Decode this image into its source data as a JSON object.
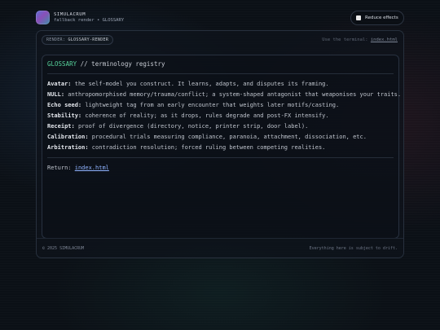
{
  "brand": {
    "name": "SIMULACRUM",
    "subtitle": "fallback render • GLOSSARY",
    "logo_icon": "gradient-square-logo"
  },
  "controls": {
    "reduce_effects_label": "Reduce effects",
    "reduce_effects_checked": false
  },
  "panel": {
    "render_label": "RENDER:",
    "render_value": "GLOSSARY-RENDER",
    "terminal_prefix": "Use the terminal:",
    "terminal_link": "index.html"
  },
  "glossary": {
    "title_accent": "GLOSSARY",
    "title_rest": "// terminology registry",
    "entries": [
      {
        "term": "Avatar:",
        "definition": "the self-model you construct. It learns, adapts, and disputes its framing."
      },
      {
        "term": "NULL:",
        "definition": "anthropomorphised memory/trauma/conflict; a system-shaped antagonist that weaponises your traits."
      },
      {
        "term": "Echo seed:",
        "definition": "lightweight tag from an early encounter that weights later motifs/casting."
      },
      {
        "term": "Stability:",
        "definition": "coherence of reality; as it drops, rules degrade and post-FX intensify."
      },
      {
        "term": "Receipt:",
        "definition": "proof of divergence (directory, notice, printer strip, door label)."
      },
      {
        "term": "Calibration:",
        "definition": "procedural trials measuring compliance, paranoia, attachment, dissociation, etc."
      },
      {
        "term": "Arbitration:",
        "definition": "contradiction resolution; forced ruling between competing realities."
      }
    ],
    "return_label": "Return:",
    "return_link": "index.html"
  },
  "footer": {
    "copyright": "© 2025 SIMULACRUM",
    "tagline": "Everything here is subject to drift."
  },
  "colors": {
    "accent_green": "#57d29b",
    "link_blue": "#8fb3ff",
    "background": "#0b1016"
  }
}
